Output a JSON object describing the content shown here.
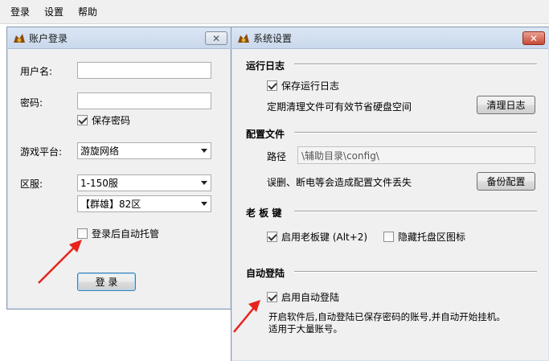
{
  "menubar": {
    "items": [
      "登录",
      "设置",
      "帮助"
    ]
  },
  "login_window": {
    "title": "账户登录",
    "username_label": "用户名:",
    "username_value": "",
    "password_label": "密码:",
    "password_value": "",
    "save_password_label": "保存密码",
    "save_password_checked": true,
    "platform_label": "游戏平台:",
    "platform_value": "游旋网络",
    "server_label": "区服:",
    "server_value": "1-150服",
    "zone_value": "【群雄】82区",
    "auto_host_label": "登录后自动托管",
    "auto_host_checked": false,
    "login_button": "登 录"
  },
  "settings_window": {
    "title": "系统设置",
    "log_section": {
      "heading": "运行日志",
      "save_log_label": "保存运行日志",
      "save_log_checked": true,
      "clean_desc": "定期清理文件可有效节省硬盘空间",
      "clean_button": "清理日志"
    },
    "config_section": {
      "heading": "配置文件",
      "path_label": "路径",
      "path_value": "\\辅助目录\\config\\",
      "backup_desc": "误删、断电等会造成配置文件丢失",
      "backup_button": "备份配置"
    },
    "boss_key_section": {
      "heading": "老 板 键",
      "enable_label": "启用老板键  (Alt+2)",
      "enable_checked": true,
      "hide_tray_label": "隐藏托盘区图标",
      "hide_tray_checked": false
    },
    "auto_login_section": {
      "heading": "自动登陆",
      "enable_label": "启用自动登陆",
      "enable_checked": true,
      "desc_line1": "开启软件后,自动登陆已保存密码的账号,并自动开始挂机。",
      "desc_line2": "适用于大量账号。"
    }
  },
  "colors": {
    "annotation_arrow": "#e8231d",
    "close_red": "#c74a35"
  }
}
